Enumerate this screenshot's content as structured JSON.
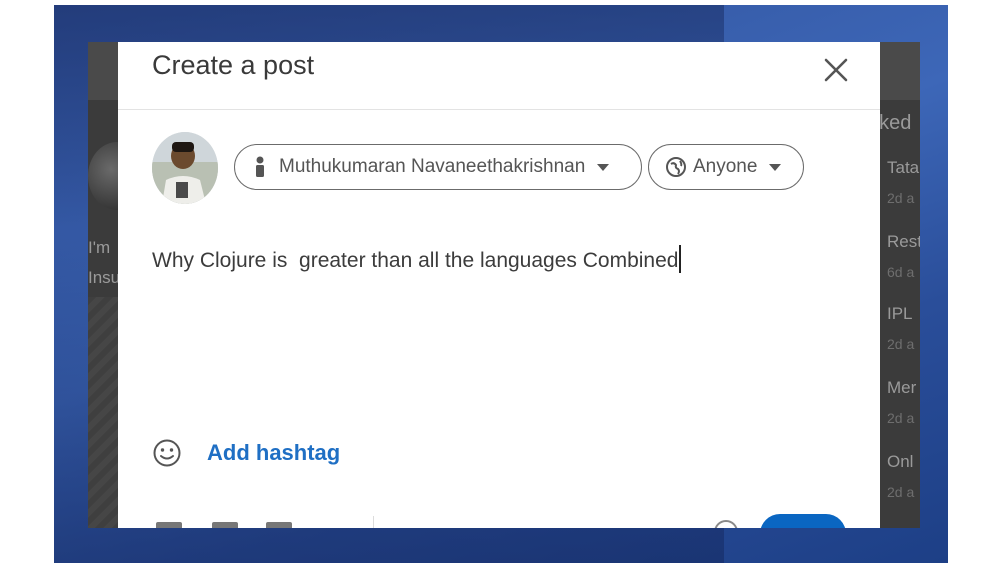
{
  "background": {
    "right_rail": {
      "heading": "nked",
      "items": [
        {
          "title": "Tata",
          "sub": "2d a"
        },
        {
          "title": "Rest",
          "sub": "6d a"
        },
        {
          "title": "IPL",
          "sub": "2d a"
        },
        {
          "title": "Mer",
          "sub": "2d a"
        },
        {
          "title": "Onl",
          "sub": "2d a"
        }
      ]
    },
    "left_feed": {
      "line1": "I'm",
      "line2": "Insu"
    }
  },
  "modal": {
    "title": "Create a post",
    "author": {
      "name": "Muthukumaran Navaneethakrishnan",
      "icon": "person-icon"
    },
    "audience": {
      "label": "Anyone",
      "icon": "globe-icon"
    },
    "post_text": "Why Clojure is  greater than all the languages Combined",
    "add_hashtag_label": "Add hashtag"
  },
  "colors": {
    "accent": "#0a66c2",
    "link": "#1f6fc4",
    "backdrop": "#2f4f97"
  }
}
